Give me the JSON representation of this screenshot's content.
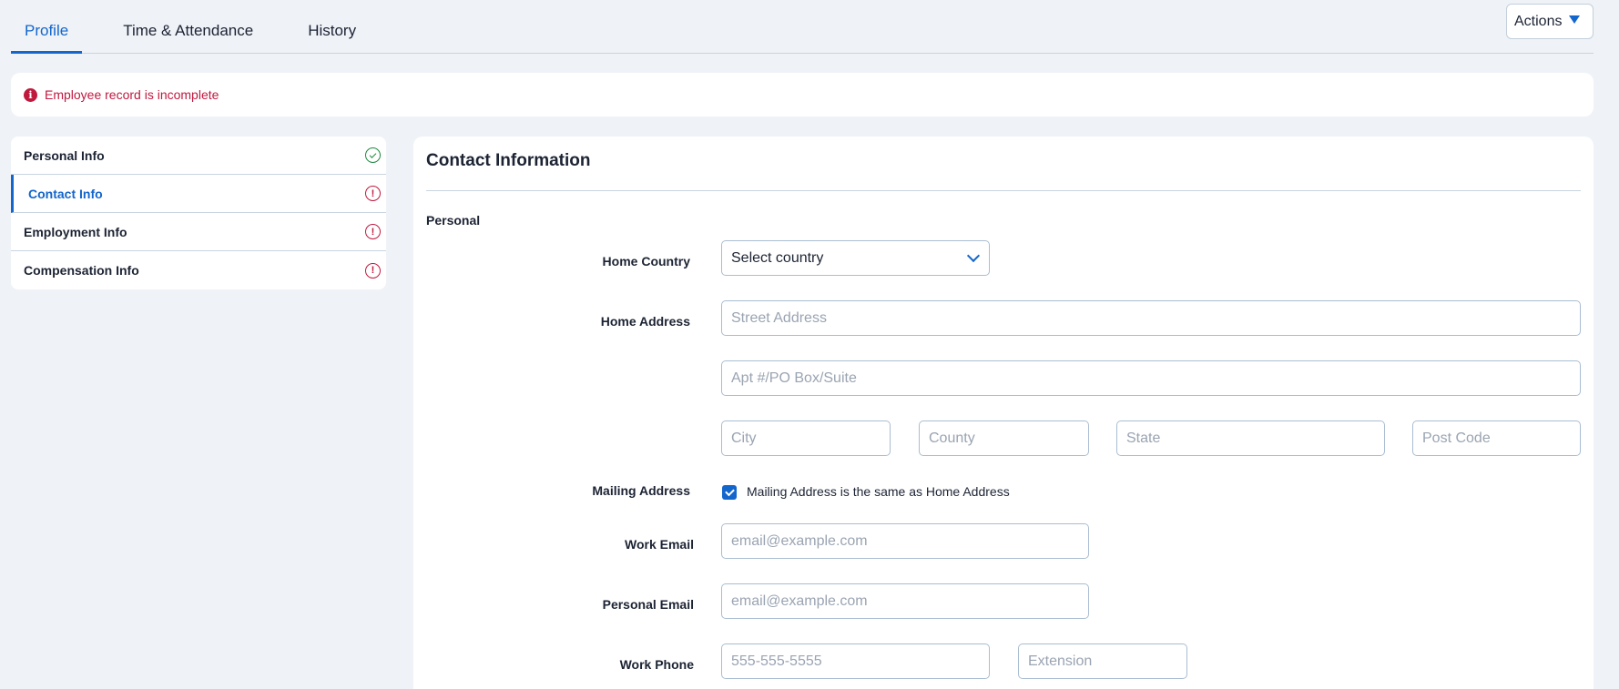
{
  "tabs": [
    {
      "label": "Profile",
      "active": true
    },
    {
      "label": "Time & Attendance",
      "active": false
    },
    {
      "label": "History",
      "active": false
    }
  ],
  "actions_label": "Actions",
  "alert": {
    "icon": "info-icon",
    "text": "Employee record is incomplete"
  },
  "sidebar": {
    "items": [
      {
        "label": "Personal Info",
        "status": "complete"
      },
      {
        "label": "Contact Info",
        "status": "incomplete",
        "active": true
      },
      {
        "label": "Employment Info",
        "status": "incomplete"
      },
      {
        "label": "Compensation Info",
        "status": "incomplete"
      }
    ]
  },
  "panel": {
    "title": "Contact Information",
    "section": "Personal",
    "labels": {
      "home_country": "Home Country",
      "home_address": "Home Address",
      "mailing_address": "Mailing Address",
      "work_email": "Work Email",
      "personal_email": "Personal Email",
      "work_phone": "Work Phone"
    },
    "country_select": "Select country",
    "placeholders": {
      "street": "Street Address",
      "apt": "Apt #/PO Box/Suite",
      "city": "City",
      "county": "County",
      "state": "State",
      "postcode": "Post Code",
      "work_email": "email@example.com",
      "personal_email": "email@example.com",
      "work_phone": "555-555-5555",
      "extension": "Extension"
    },
    "mailing_same_label": "Mailing Address is the same as Home Address",
    "mailing_same_checked": true
  },
  "colors": {
    "accent": "#1366cc",
    "error": "#c0193e",
    "success": "#1d8a3e"
  }
}
